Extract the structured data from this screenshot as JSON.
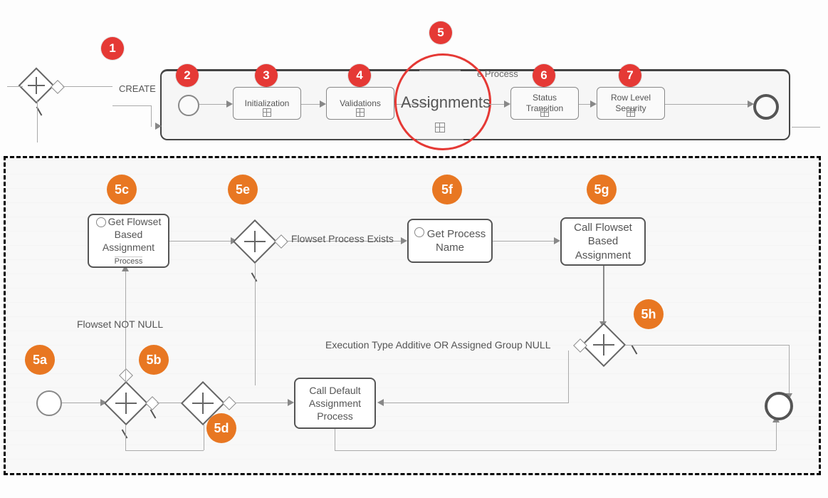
{
  "top": {
    "laneLabel": "CREATE",
    "laneHeader": "e Process",
    "tasks": {
      "init": "Initialization",
      "valid": "Validations",
      "assign": "Assignments",
      "status": "Status Transition",
      "rls": "Row Level Security"
    },
    "badges": {
      "b1": "1",
      "b2": "2",
      "b3": "3",
      "b4": "4",
      "b5": "5",
      "b6": "6",
      "b7": "7"
    }
  },
  "detail": {
    "badges": {
      "a": "5a",
      "b": "5b",
      "c": "5c",
      "d": "5d",
      "e": "5e",
      "f": "5f",
      "g": "5g",
      "h": "5h"
    },
    "labels": {
      "flowsetNotNull": "Flowset NOT NULL",
      "flowsetExists": "Flowset Process Exists",
      "execAdditive": "Execution Type Additive OR Assigned Group NULL",
      "getFlowset": "Get Flowset Based Assignment",
      "getFlowset2": "Process",
      "getProcess": "Get Process Name",
      "callFlowset": "Call Flowset Based Assignment",
      "callDefault": "Call Default Assignment Process"
    }
  }
}
